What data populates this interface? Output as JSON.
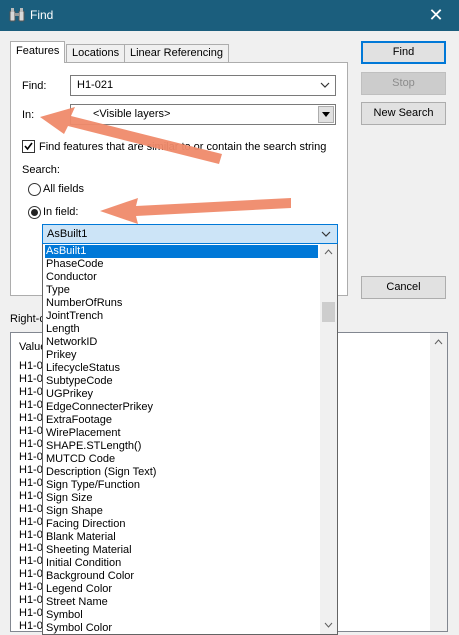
{
  "window": {
    "title": "Find",
    "close_glyph": "✕"
  },
  "tabs": [
    {
      "label": "Features",
      "active": true
    },
    {
      "label": "Locations",
      "active": false
    },
    {
      "label": "Linear Referencing",
      "active": false
    }
  ],
  "form": {
    "find_label": "Find:",
    "find_value": "H1-021",
    "in_label": "In:",
    "in_value": "<Visible layers>",
    "similar_checkbox_label": "Find features that are similar to or contain the search string",
    "similar_checked": true,
    "search_label": "Search:",
    "all_fields_label": "All fields",
    "in_field_label": "In field:",
    "in_field_selected": true,
    "field_value": "AsBuilt1"
  },
  "buttons": {
    "find": "Find",
    "stop": "Stop",
    "new_search": "New Search",
    "cancel": "Cancel"
  },
  "results": {
    "label_fragment": "Right-c",
    "header_fragment": "Value",
    "row_fragment": "H1-0",
    "row_count": 21
  },
  "field_options": [
    "AsBuilt1",
    "PhaseCode",
    "Conductor",
    "Type",
    "NumberOfRuns",
    "JointTrench",
    "Length",
    "NetworkID",
    "Prikey",
    "LifecycleStatus",
    "SubtypeCode",
    "UGPrikey",
    "EdgeConnecterPrikey",
    "ExtraFootage",
    "WirePlacement",
    "SHAPE.STLength()",
    "MUTCD Code",
    "Description (Sign Text)",
    "Sign Type/Function",
    "Sign Size",
    "Sign Shape",
    "Facing Direction",
    "Blank Material",
    "Sheeting Material",
    "Initial Condition",
    "Background Color",
    "Legend Color",
    "Street Name",
    "Symbol",
    "Symbol Color"
  ],
  "colors": {
    "titlebar": "#1b5e7d",
    "selection": "#0078d7",
    "annotation_arrow": "#ef8a6a"
  }
}
